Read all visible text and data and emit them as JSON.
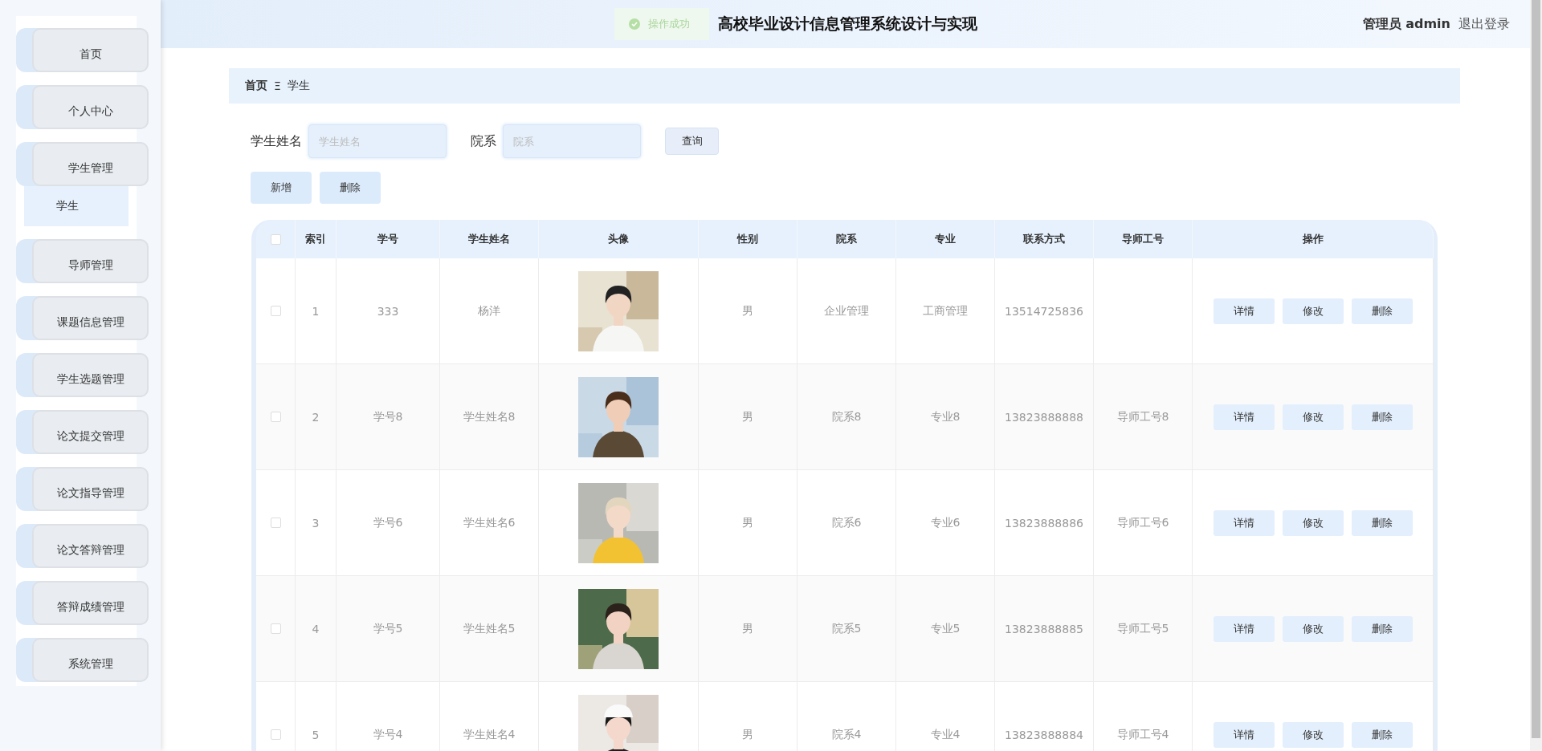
{
  "sidebar": {
    "items": [
      {
        "label": "首页",
        "selected": false
      },
      {
        "label": "个人中心",
        "selected": false
      },
      {
        "label": "学生管理",
        "selected": false,
        "children": [
          {
            "label": "学生",
            "selected": true
          }
        ]
      },
      {
        "label": "导师管理",
        "selected": false
      },
      {
        "label": "课题信息管理",
        "selected": false
      },
      {
        "label": "学生选题管理",
        "selected": false
      },
      {
        "label": "论文提交管理",
        "selected": false
      },
      {
        "label": "论文指导管理",
        "selected": false
      },
      {
        "label": "论文答辩管理",
        "selected": false
      },
      {
        "label": "答辩成绩管理",
        "selected": false
      },
      {
        "label": "系统管理",
        "selected": false
      }
    ]
  },
  "header": {
    "title": "高校毕业设计信息管理系统设计与实现",
    "user": "管理员 admin",
    "logout": "退出登录"
  },
  "toast": {
    "message": "操作成功"
  },
  "breadcrumb": [
    "首页",
    "Ξ",
    "学生"
  ],
  "search": {
    "fields": [
      {
        "label": "学生姓名",
        "placeholder": "学生姓名"
      },
      {
        "label": "院系",
        "placeholder": "院系"
      }
    ],
    "button": "查询"
  },
  "toolbar": [
    "新增",
    "删除"
  ],
  "table": {
    "header_checked": false,
    "columns": [
      "索引",
      "学号",
      "学生姓名",
      "头像",
      "性别",
      "院系",
      "专业",
      "联系方式",
      "导师工号",
      "操作"
    ],
    "rows": [
      {
        "checked": false,
        "index": "1",
        "student_no": "333",
        "name": "杨洋",
        "gender": "男",
        "department": "企业管理",
        "major": "工商管理",
        "phone": "13514725836",
        "actions": [
          "详情",
          "修改",
          "删除"
        ]
      },
      {
        "checked": false,
        "index": "2",
        "student_no": "学号8",
        "name": "学生姓名8",
        "gender": "男",
        "department": "院系8",
        "major": "专业8",
        "phone": "13823888888",
        "tutor_id": "导师工号8",
        "actions": [
          "详情",
          "修改",
          "删除"
        ]
      },
      {
        "checked": false,
        "index": "3",
        "student_no": "学号6",
        "name": "学生姓名6",
        "gender": "男",
        "department": "院系6",
        "major": "专业6",
        "phone": "13823888886",
        "tutor_id": "导师工号6",
        "actions": [
          "详情",
          "修改",
          "删除"
        ]
      },
      {
        "checked": false,
        "index": "4",
        "student_no": "学号5",
        "name": "学生姓名5",
        "gender": "男",
        "department": "院系5",
        "major": "专业5",
        "phone": "13823888885",
        "tutor_id": "导师工号5",
        "actions": [
          "详情",
          "修改",
          "删除"
        ]
      },
      {
        "checked": false,
        "index": "5",
        "student_no": "学号4",
        "name": "学生姓名4",
        "gender": "男",
        "department": "院系4",
        "major": "专业4",
        "phone": "13823888884",
        "tutor_id": "导师工号4",
        "actions": [
          "详情",
          "修改",
          "删除"
        ]
      }
    ]
  }
}
